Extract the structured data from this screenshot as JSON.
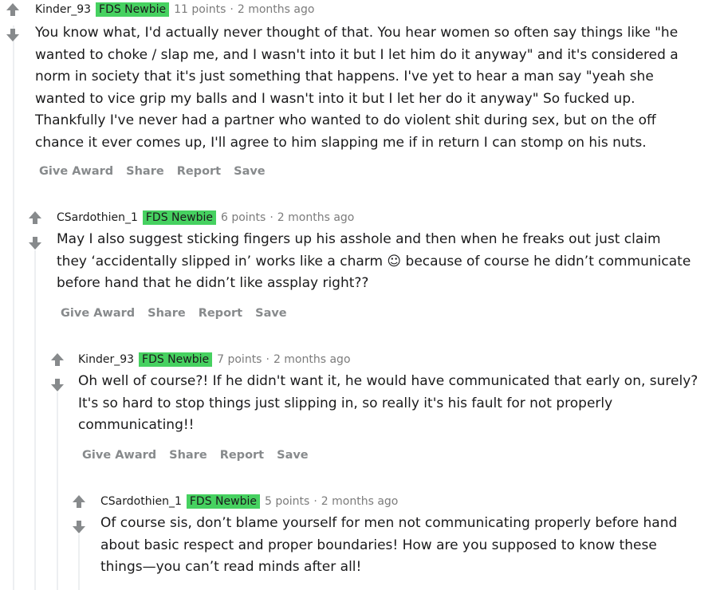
{
  "comments": [
    {
      "author": "Kinder_93",
      "flair": "FDS Newbie",
      "points": "11 points",
      "time": "2 months ago",
      "body": "You know what, I'd actually never thought of that. You hear women so often say things like \"he wanted to choke / slap me, and I wasn't into it but I let him do it anyway\" and it's considered a norm in society that it's just something that happens. I've yet to hear a man say \"yeah she wanted to vice grip my balls and I wasn't into it but I let her do it anyway\" So fucked up. Thankfully I've never had a partner who wanted to do violent shit during sex, but on the off chance it ever comes up, I'll agree to him slapping me if in return I can stomp on his nuts."
    },
    {
      "author": "CSardothien_1",
      "flair": "FDS Newbie",
      "points": "6 points",
      "time": "2 months ago",
      "body": "May I also suggest sticking fingers up his asshole and then when he freaks out just claim they ‘accidentally slipped in’ works like a charm ☺ because of course he didn’t communicate before hand that he didn’t like assplay right??"
    },
    {
      "author": "Kinder_93",
      "flair": "FDS Newbie",
      "points": "7 points",
      "time": "2 months ago",
      "body": "Oh well of course?! If he didn't want it, he would have communicated that early on, surely? It's so hard to stop things just slipping in, so really it's his fault for not properly communicating!!"
    },
    {
      "author": "CSardothien_1",
      "flair": "FDS Newbie",
      "points": "5 points",
      "time": "2 months ago",
      "body": "Of course sis, don’t blame yourself for men not communicating properly before hand about basic respect and proper boundaries! How are you supposed to know these things—you can’t read minds after all!"
    }
  ],
  "actions": {
    "give_award": "Give Award",
    "share": "Share",
    "report": "Report",
    "save": "Save"
  },
  "colors": {
    "flair_bg": "#46d160",
    "vote_arrow": "#878a8c",
    "meta_text": "#7c7c7c",
    "thread_line": "#edeff1"
  },
  "icons": [
    "upvote-icon",
    "downvote-icon"
  ]
}
